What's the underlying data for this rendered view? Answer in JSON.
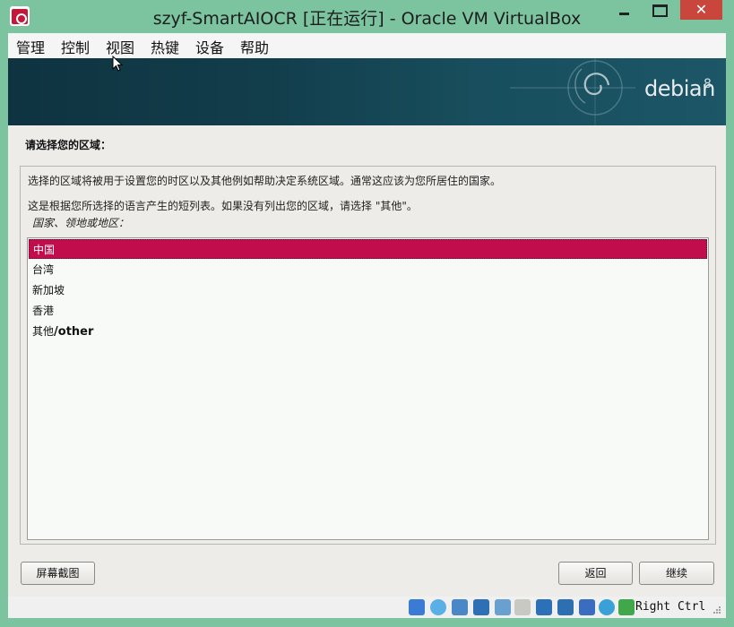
{
  "window": {
    "title": "szyf-SmartAIOCR [正在运行] - Oracle VM VirtualBox",
    "buttons": {
      "minimize": "minimize-icon",
      "maximize": "maximize-icon",
      "close": "close-icon"
    }
  },
  "menu": [
    {
      "label": "管理"
    },
    {
      "label": "控制"
    },
    {
      "label": "视图"
    },
    {
      "label": "热键"
    },
    {
      "label": "设备"
    },
    {
      "label": "帮助"
    }
  ],
  "installer": {
    "banner": {
      "brand": "debian",
      "version": "8"
    },
    "prompt": "请选择您的区域：",
    "description_1": "选择的区域将被用于设置您的时区以及其他例如帮助决定系统区域。通常这应该为您所居住的国家。",
    "description_2": "这是根据您所选择的语言产生的短列表。如果没有列出您的区域，请选择 \"其他\"。",
    "field_label": "国家、领地或地区：",
    "options": [
      {
        "label": "中国",
        "selected": true
      },
      {
        "label": "台湾",
        "selected": false
      },
      {
        "label": "新加坡",
        "selected": false
      },
      {
        "label": "香港",
        "selected": false
      },
      {
        "label_cjk": "其他",
        "label_ascii": "/other",
        "selected": false
      }
    ],
    "buttons": {
      "screenshot": "屏幕截图",
      "back": "返回",
      "continue": "继续"
    },
    "selection_color": "#c20d4d"
  },
  "statusbar": {
    "icons": [
      "hard-disk-icon",
      "optical-disk-icon",
      "audio-icon",
      "network-icon",
      "usb-icon",
      "shared-folder-icon",
      "display-icon",
      "capture-icon",
      "virtualization-icon",
      "mouse-integration-icon",
      "keyboard-capture-icon"
    ],
    "host_key": "Right Ctrl"
  }
}
